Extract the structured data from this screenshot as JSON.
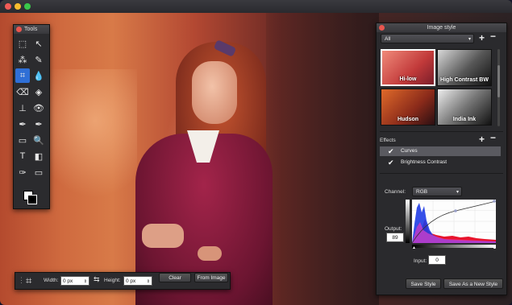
{
  "window": {
    "traffic_lights": [
      "#f25b57",
      "#f8bc2e",
      "#3ac74a"
    ]
  },
  "tools_panel": {
    "title": "Tools",
    "tools": [
      {
        "name": "marquee-icon",
        "glyph": "⬚"
      },
      {
        "name": "pointer-icon",
        "glyph": "↖"
      },
      {
        "name": "magic-wand-icon",
        "glyph": "⁂"
      },
      {
        "name": "brush-icon",
        "glyph": "✎"
      },
      {
        "name": "crop-icon",
        "glyph": "⌗",
        "selected": true
      },
      {
        "name": "drop-icon",
        "glyph": "💧"
      },
      {
        "name": "eraser-icon",
        "glyph": "⌫"
      },
      {
        "name": "fill-icon",
        "glyph": "◈"
      },
      {
        "name": "stamp-icon",
        "glyph": "⊥"
      },
      {
        "name": "eye-icon",
        "glyph": "👁"
      },
      {
        "name": "eyedropper-icon",
        "glyph": "✒"
      },
      {
        "name": "eyedropper-plus-icon",
        "glyph": "✒"
      },
      {
        "name": "rectangle-tool-icon",
        "glyph": "▭"
      },
      {
        "name": "zoom-icon",
        "glyph": "🔍"
      },
      {
        "name": "text-icon",
        "glyph": "T"
      },
      {
        "name": "gradient-icon",
        "glyph": "◧"
      },
      {
        "name": "pen-icon",
        "glyph": "✑"
      },
      {
        "name": "shape-icon",
        "glyph": "▭"
      }
    ]
  },
  "crop_bar": {
    "width_label": "Width:",
    "width_value": "0 px",
    "height_label": "Height:",
    "height_value": "0 px",
    "clear_label": "Clear",
    "from_image_label": "From Image"
  },
  "image_style": {
    "title": "Image style",
    "filter_value": "All",
    "thumbs": [
      {
        "label": "Hi-low",
        "selected": true,
        "bg": "linear-gradient(135deg,#f08a7a,#c23a3a 60%,#7a1e2a)"
      },
      {
        "label": "High Contrast BW",
        "selected": false,
        "bg": "linear-gradient(135deg,#d8d8d8,#555 55%,#111)"
      },
      {
        "label": "Hudson",
        "selected": false,
        "bg": "linear-gradient(135deg,#e06a2a,#8a2a1a 60%,#2a0f12)"
      },
      {
        "label": "India Ink",
        "selected": false,
        "bg": "linear-gradient(135deg,#eee,#777 50%,#111)"
      }
    ],
    "effects_title": "Effects",
    "effects": [
      {
        "label": "Curves",
        "checked": true,
        "selected": true
      },
      {
        "label": "Brightness Contrast",
        "checked": true,
        "selected": false
      }
    ],
    "channel_label": "Channel:",
    "channel_value": "RGB",
    "output_label": "Output:",
    "output_value": "89",
    "input_label": "Input:",
    "input_value": "0",
    "save_style_label": "Save Style",
    "save_new_style_label": "Save As a New Style"
  }
}
